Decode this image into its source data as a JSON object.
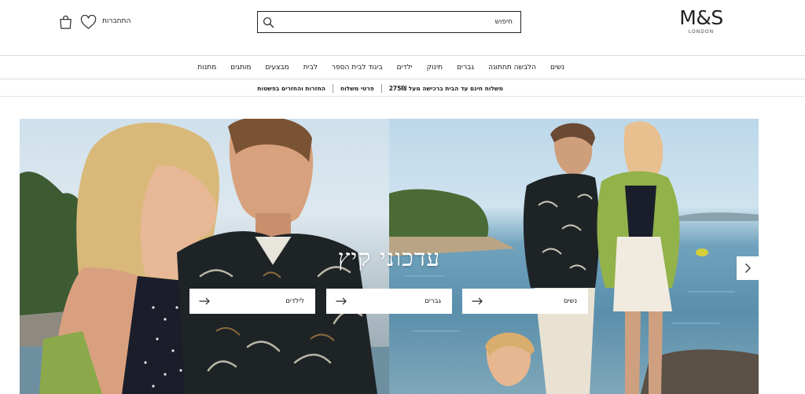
{
  "header": {
    "logo": {
      "mark": "M&S",
      "sub": "LONDON"
    },
    "search": {
      "placeholder": "חיפוש",
      "icon": "search-icon"
    },
    "signin": "התחברות",
    "wishlist_icon": "heart-icon",
    "bag_icon": "shopping-bag-icon"
  },
  "nav": {
    "items": [
      "נשים",
      "הלבשה תחתונה",
      "גברים",
      "תינוק",
      "ילדים",
      "ביגוד לבית הספר",
      "לבית",
      "מבצעים",
      "מותגים",
      "מתנות"
    ]
  },
  "promo": {
    "items": [
      "משלוח חינם עד הבית ברכישה מעל 275₪",
      "פרטי משלוח",
      "החזרות והחזרים בפשטות"
    ]
  },
  "hero": {
    "title": "עדכוני קיץ",
    "ctas": [
      {
        "label": "נשים"
      },
      {
        "label": "גברים"
      },
      {
        "label": "לילדים"
      }
    ],
    "next_icon": "chevron-right-icon"
  },
  "colors": {
    "text": "#1a1a1a",
    "border": "#dcdcdc",
    "background": "#ffffff"
  }
}
